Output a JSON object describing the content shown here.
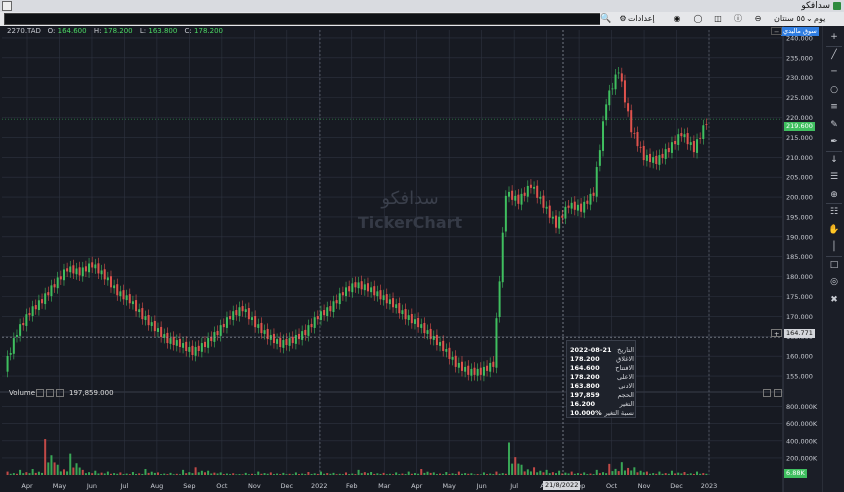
{
  "window": {
    "title": "سدافكو"
  },
  "toolbar": {
    "search_value": "",
    "settings_label": "إعدادات",
    "period_label": "٥٥ سنتان",
    "interval_label": "يوم"
  },
  "legend": {
    "symbol": "2270.TAD",
    "open_label": "O:",
    "open": "164.600",
    "high_label": "H:",
    "high": "178.200",
    "low_label": "L:",
    "low": "163.800",
    "close_label": "C:",
    "close": "178.200"
  },
  "watermark": {
    "name": "سدافكو",
    "brand": "TickerChart"
  },
  "price_axis": {
    "ticks": [
      "240.000",
      "235.000",
      "230.000",
      "225.000",
      "220.000",
      "215.000",
      "210.000",
      "205.000",
      "200.000",
      "195.000",
      "190.000",
      "185.000",
      "180.000",
      "175.000",
      "170.000",
      "165.000",
      "160.000",
      "155.000"
    ],
    "last_price_badge": "219.600",
    "crosshair_badge": "164.771",
    "chart_type_label": "سوق ماليدي"
  },
  "volume_panel": {
    "label": "Volume",
    "value": "197,859.000",
    "ticks": [
      "800.000K",
      "600.000K",
      "400.000K",
      "200.000K"
    ],
    "last_badge": "6.88K"
  },
  "time_axis": {
    "labels": [
      "Apr",
      "May",
      "Jun",
      "Jul",
      "Aug",
      "Sep",
      "Oct",
      "Nov",
      "Dec",
      "2022",
      "Feb",
      "Mar",
      "Apr",
      "May",
      "Jun",
      "Jul",
      "Aug",
      "Sep",
      "Oct",
      "Nov",
      "Dec",
      "2023"
    ],
    "crosshair_date": "21/8/2022"
  },
  "tooltip": {
    "rows": [
      {
        "label": "التاريخ",
        "value": "2022-08-21"
      },
      {
        "label": "الاغلاق",
        "value": "178.200"
      },
      {
        "label": "الافتتاح",
        "value": "164.600"
      },
      {
        "label": "الاعلى",
        "value": "178.200"
      },
      {
        "label": "الادنى",
        "value": "163.800"
      },
      {
        "label": "الحجم",
        "value": "197,859"
      },
      {
        "label": "التغير",
        "value": "16.200"
      },
      {
        "label": "نسبة التغير",
        "value": "10.000%"
      }
    ]
  },
  "colors": {
    "background": "#1b1e27",
    "up": "#3fbf5f",
    "down": "#e0524d",
    "grid": "#2e3340",
    "last_price": "#3fbf5f",
    "accent": "#2f7de1"
  },
  "sidebar_tools": [
    "crosshair-icon",
    "trendline-icon",
    "horizontal-line-icon",
    "circle-icon",
    "fibonacci-icon",
    "brush-icon",
    "pen-icon",
    "arrow-down-icon",
    "indicators-icon",
    "zoom-icon",
    "pattern-icon",
    "hand-icon",
    "ruler-icon",
    "eraser-icon",
    "hide-icon",
    "trash-icon"
  ],
  "chart_data": {
    "type": "line",
    "title": "",
    "xlabel": "",
    "ylabel": "",
    "ylim": [
      152,
      242
    ],
    "series": [
      {
        "values": [
          157,
          166,
          171,
          174,
          178,
          182,
          181,
          183,
          180,
          176,
          174,
          170,
          167,
          164,
          163,
          161,
          163,
          166,
          170,
          172,
          168,
          165,
          163,
          164,
          166,
          170,
          172,
          176,
          178,
          177,
          175,
          173,
          170,
          168,
          165,
          162,
          158,
          156,
          156,
          158,
          201,
          199,
          203,
          198,
          193,
          198,
          197,
          201,
          224,
          232,
          217,
          210,
          209,
          212,
          216,
          212,
          219
        ]
      }
    ],
    "volume_ylim": [
      0,
      900
    ],
    "volume_series": [
      {
        "values": [
          40,
          60,
          70,
          420,
          120,
          250,
          60,
          50,
          40,
          30,
          35,
          70,
          30,
          25,
          60,
          90,
          50,
          30,
          20,
          25,
          40,
          30,
          25,
          30,
          35,
          40,
          25,
          30,
          60,
          35,
          25,
          30,
          40,
          70,
          30,
          35,
          40,
          20,
          30,
          40,
          380,
          120,
          90,
          60,
          50,
          40,
          30,
          60,
          130,
          150,
          90,
          40,
          40,
          50,
          35,
          40,
          30
        ]
      }
    ]
  }
}
